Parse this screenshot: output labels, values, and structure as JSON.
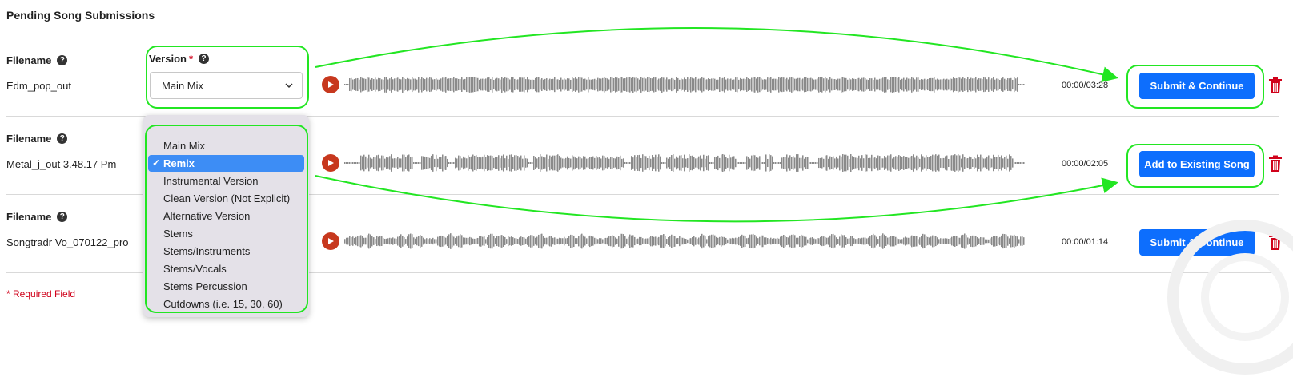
{
  "page": {
    "title": "Pending Song Submissions",
    "required_note": "* Required Field"
  },
  "version_field": {
    "label": "Version",
    "required_mark": "*",
    "selected": "Main Mix"
  },
  "rows": [
    {
      "filename_label": "Filename",
      "filename": "Edm_pop_out",
      "time": "00:00/03:28",
      "action": "Submit & Continue"
    },
    {
      "filename_label": "Filename",
      "filename": "Metal_j_out 3.48.17 Pm",
      "time": "00:00/02:05",
      "action": "Add to Existing Song"
    },
    {
      "filename_label": "Filename",
      "filename": "Songtradr Vo_070122_pro",
      "time": "00:00/01:14",
      "action": "Submit & Continue"
    }
  ],
  "dropdown": {
    "selected_index": 1,
    "check_glyph": "✓",
    "options": [
      "Main Mix",
      "Remix",
      "Instrumental Version",
      "Clean Version (Not Explicit)",
      "Alternative Version",
      "Stems",
      "Stems/Instruments",
      "Stems/Vocals",
      "Stems Percussion",
      "Cutdowns (i.e. 15, 30, 60)"
    ]
  },
  "icons": {
    "help": "question-circle-icon",
    "play": "play-icon",
    "delete": "trash-icon",
    "select": "chevron-down-icon"
  },
  "colors": {
    "accent": "#0d6efd",
    "play": "#c7381e",
    "delete": "#d0021b",
    "highlight": "#22e622",
    "waveform": "#8a8a8a",
    "required": "#d0021b",
    "dropdown_bg": "#e4e1e8",
    "dropdown_selected": "#3d8df5"
  }
}
